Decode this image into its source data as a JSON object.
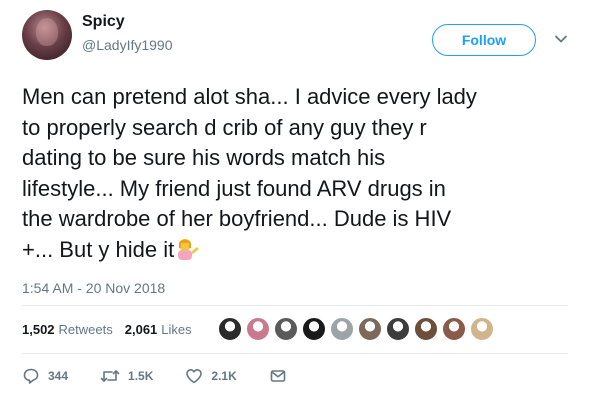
{
  "user": {
    "display_name": "Spicy",
    "handle": "@LadyIfy1990",
    "avatar_icon": "profile-photo"
  },
  "follow_label": "Follow",
  "tweet": {
    "text": "Men can pretend alot sha... I advice every lady\nto properly search d crib of any guy they r\ndating to be sure his words match his\nlifestyle... My friend just found ARV drugs in\nthe wardrobe of her boyfriend... Dude is HIV\n+... But y hide it",
    "emoji_icon": "person-tipping-hand-emoji"
  },
  "timestamp": "1:54 AM - 20 Nov 2018",
  "stats": {
    "retweets_count": "1,502",
    "retweets_label": "Retweets",
    "likes_count": "2,061",
    "likes_label": "Likes"
  },
  "likers": [
    {
      "name": "liker-1",
      "color": "#2b2b2b"
    },
    {
      "name": "liker-2",
      "color": "#c97a8e"
    },
    {
      "name": "liker-3",
      "color": "#5a5a5a"
    },
    {
      "name": "liker-4",
      "color": "#1a1a1a"
    },
    {
      "name": "liker-5",
      "color": "#9ea3a8"
    },
    {
      "name": "liker-6",
      "color": "#7b6a5c"
    },
    {
      "name": "liker-7",
      "color": "#3c3c3c"
    },
    {
      "name": "liker-8",
      "color": "#6b4f3a"
    },
    {
      "name": "liker-9",
      "color": "#8a5a4a"
    },
    {
      "name": "liker-10",
      "color": "#d2b48c"
    }
  ],
  "actions": {
    "replies": "344",
    "retweets": "1.5K",
    "likes": "2.1K"
  },
  "colors": {
    "accent": "#1da1f2",
    "secondary_text": "#657786",
    "divider": "#e6ecf0"
  }
}
